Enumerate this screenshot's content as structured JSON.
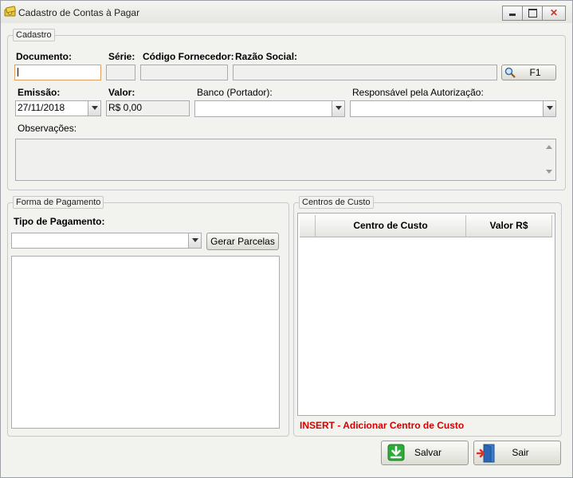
{
  "window": {
    "title": "Cadastro de Contas à Pagar",
    "icons": {
      "app": "money-icon",
      "minimize": "minimize-icon",
      "maximize": "maximize-icon",
      "close": "close-icon"
    },
    "close_glyph": "✕"
  },
  "cadastro": {
    "group_label": "Cadastro",
    "labels": {
      "documento": "Documento:",
      "serie": "Série:",
      "codigo_fornecedor": "Código Fornecedor:",
      "razao_social": "Razão Social:",
      "emissao": "Emissão:",
      "valor": "Valor:",
      "banco": "Banco (Portador):",
      "responsavel": "Responsável pela Autorização:",
      "observacoes": "Observações:"
    },
    "values": {
      "documento": "",
      "serie": "",
      "codigo_fornecedor": "",
      "razao_social": "",
      "emissao": "27/11/2018",
      "valor": "R$ 0,00",
      "banco": "",
      "responsavel": "",
      "observacoes": ""
    },
    "search_button_label": "F1",
    "search_icon": "magnifier-icon"
  },
  "pagamento": {
    "group_label": "Forma de Pagamento",
    "tipo_label": "Tipo de Pagamento:",
    "tipo_value": "",
    "gerar_label": "Gerar Parcelas"
  },
  "centros": {
    "group_label": "Centros de Custo",
    "columns": [
      "Centro de Custo",
      "Valor R$"
    ],
    "rows": [],
    "hint": "INSERT - Adicionar Centro de Custo",
    "hint_color": "#d40000"
  },
  "actions": {
    "salvar_label": "Salvar",
    "sair_label": "Sair",
    "salvar_icon": "download-arrow-icon",
    "sair_icon": "exit-door-icon",
    "salvar_icon_color": "#2eaa3a",
    "sair_icon_color": "#3b7fd1"
  }
}
